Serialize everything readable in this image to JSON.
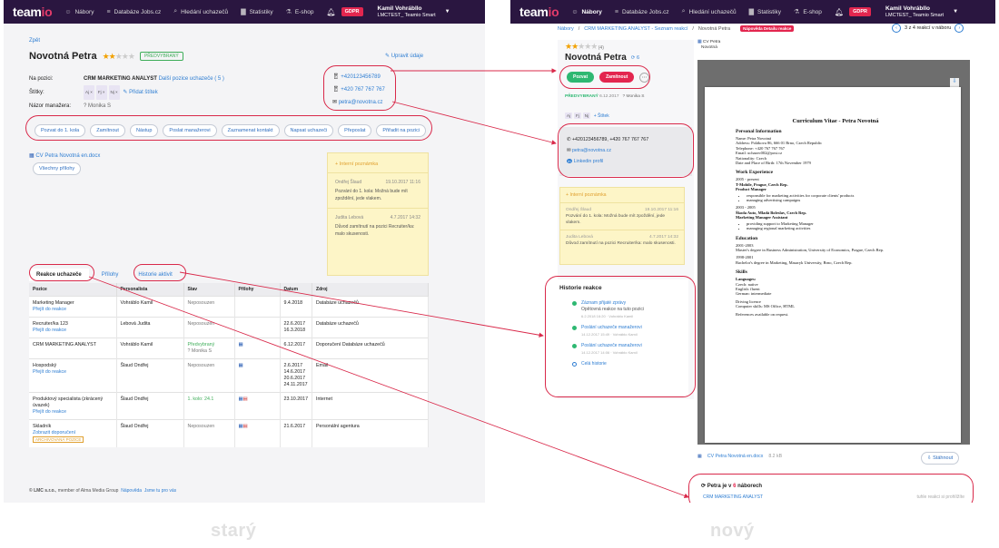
{
  "header": {
    "logo_main": "team",
    "logo_accent": "io",
    "nav": [
      {
        "icon": "people-icon",
        "glyph": "☺",
        "label": "Nábory"
      },
      {
        "icon": "database-icon",
        "glyph": "≡",
        "label": "Databáze Jobs.cz"
      },
      {
        "icon": "search-icon",
        "glyph": "⌕",
        "label": "Hledání uchazečů"
      },
      {
        "icon": "chart-icon",
        "glyph": "▇",
        "label": "Statistiky"
      },
      {
        "icon": "cart-icon",
        "glyph": "⚗",
        "label": "E-shop"
      }
    ],
    "gdpr": "GDPR",
    "user_name": "Kamil Vohrábllo",
    "user_company": "LMCTEST_ Teamio Smart"
  },
  "old": {
    "back": "Zpět",
    "name": "Novotná Petra",
    "status": "PŘEDVYBRANÝ",
    "edit": "Upravit údaje",
    "position_label": "Na pozici:",
    "position_value": "CRM MARKETING ANALYST",
    "position_more": "Další pozice uchazeče ( 5 )",
    "tags_label": "Štítky:",
    "tags": [
      "Aj",
      "Fj",
      "Nj"
    ],
    "add_tag": "Přidat štítek",
    "manager_label": "Názor manažera:",
    "manager_value": "Monika S",
    "phone1": "+420123456789",
    "phone2": "+420 767 767 767",
    "email": "petra@novotna.cz",
    "actions": [
      "Pozvat do 1. kola",
      "Zamítnout",
      "Nástup",
      "Poslat manažerovi",
      "Zaznamenat kontakt",
      "Napsat uchazeči",
      "Přeposlat",
      "Přiřadit na pozici"
    ],
    "cv_file": "CV Petra Novotná en.docx",
    "all_attachments": "Všechny přílohy",
    "notes_title": "Interní poznámka",
    "notes": [
      {
        "author": "Ondřej Šlaud",
        "date": "19.10.2017 11:16",
        "text": "Pozvání do 1. kola: Možná bude mít zpoždění, jede vlakem."
      },
      {
        "author": "Judita Lebová",
        "date": "4.7.2017 14:32",
        "text": "Důvod zamítnutí na pozici Recruiter/ka: malo skusenosti."
      }
    ],
    "tabs": [
      "Reakce uchazeče",
      "Přílohy",
      "Historie aktivit"
    ],
    "table_headers": [
      "Pozice",
      "Personalista",
      "Stav",
      "Přílohy",
      "Datum",
      "Zdroj"
    ],
    "rows": [
      {
        "pos": "Marketing Manager",
        "link": "Přejít do reakce",
        "hr": "Vohráblo Kamil",
        "state": "Neposouzen",
        "att": "",
        "date": "9.4.2018",
        "src": "Databáze uchazečů"
      },
      {
        "pos": "Recruiter/ka 123",
        "link": "Přejít do reakce",
        "hr": "Lebová Judita",
        "state": "Neposouzen",
        "att": "",
        "date": "22.6.2017 16.3.2018",
        "src": "Databáze uchazečů"
      },
      {
        "pos": "CRM MARKETING ANALYST",
        "link": "",
        "hr": "Vohráblo Kamil",
        "state": "Předvybraný",
        "state2": "Monika S",
        "att": "doc",
        "date": "6.12.2017",
        "src": "Doporučení Databáze uchazečů"
      },
      {
        "pos": "Hospodský",
        "link": "Přejít do reakce",
        "hr": "Šlaud Ondřej",
        "state": "Neposouzen",
        "att": "doc",
        "date": "2.6.2017 14.6.2017 20.6.2017 24.11.2017",
        "src": "Email"
      },
      {
        "pos": "Produktový specialista (zkrácený úvazek)",
        "link": "Přejít do reakce",
        "hr": "Šlaud Ondřej",
        "state": "1. kolo: 24.1",
        "att": "doc pdf",
        "date": "23.10.2017",
        "src": "Internet"
      },
      {
        "pos": "Skladník",
        "link": "Zobrazit doporučení",
        "archived": "ARCHIVOVANÁ POZICE",
        "hr": "Šlaud Ondřej",
        "state": "Neposouzen",
        "att": "doc pdf",
        "date": "21.6.2017",
        "src": "Personální agentura"
      }
    ],
    "footer_company": "© LMC s.r.o.",
    "footer_member": ", member of Alma Media Group",
    "footer_help": "Nápověda",
    "footer_terms": "Jsme tu pro vás"
  },
  "new": {
    "breadcrumb": [
      "Nábory",
      "CRM MARKETING ANALYST - Seznam reakcí",
      "Novotná Petra"
    ],
    "new_tag": "Nápověda Detailu reakce",
    "pager": "3 z 4 reakcí v náboru",
    "rating_count": "(4)",
    "name": "Novotná Petra",
    "views": "6",
    "btn_invite": "Pozvat",
    "btn_reject": "Zamítnout",
    "status": "PŘEDVYBRANÝ",
    "status_date": "6.12.2017",
    "manager": "Monika S",
    "tags": [
      "Aj",
      "Fj",
      "Nj"
    ],
    "add_tag": "+ Štítek",
    "phones": "+420123456789, +420 767 767 767",
    "email": "petra@novotna.cz",
    "linkedin": "Linkedin profil",
    "notes_title": "+ Interní poznámka",
    "notes": [
      {
        "author": "Ondřej Šlaud",
        "date": "19.10.2017 11:16",
        "text": "Pozvání do 1. kola: Možná bude mít zpoždění, jede vlakem."
      },
      {
        "author": "Judita Lebová",
        "date": "4.7.2017 14:32",
        "text": "Důvod zamítnutí na pozici Recruiter/ka: malo skusenosti."
      }
    ],
    "history_title": "Historie reakce",
    "history": [
      {
        "title": "Záznam přijaté zprávy",
        "sub": "Opětovná reakce na tuto pozici",
        "meta": "6.2.2018 16:20 · Vohráblo Kamil"
      },
      {
        "title": "Poslání uchazeče manažerovi",
        "sub": "",
        "meta": "14.12.2017 15:49 · Vohráblo Kamil"
      },
      {
        "title": "Poslání uchazeče manažerovi",
        "sub": "",
        "meta": "14.12.2017 14:06 · Vohráblo Kamil"
      }
    ],
    "history_all": "Celá historie",
    "cv_tab_name": "CV Petra",
    "cv_tab_sub": "Novotná",
    "cv_file": "CV Petra Novotná en.docx",
    "cv_size": "8.2 kB",
    "download": "Stáhnout",
    "other_title_pre": "Petra je v",
    "other_count": "6",
    "other_title_post": "náborech",
    "other_first": "CRM MARKETING ANALYST",
    "other_first_note": "tuhle reakci si prohlížíte"
  },
  "cv": {
    "title": "Curriculum Vitae - Petra Novotná",
    "personal_h": "Personal Information",
    "personal": [
      "Name: Petra Novotná",
      "Address: Polákova 86, 666 01 Brno, Czech Republic",
      "Telephone: +420 767 767 767",
      "Email: uchazec002@post.cz",
      "Nationality: Czech",
      "Date and Place of Birth: 17th November 1979"
    ],
    "work_h": "Work Experience",
    "job1_dates": "2005 - present",
    "job1_company": "T-Mobile, Prague, Czech Rep.",
    "job1_role": "Product Manager",
    "job1_bullets": [
      "responsible for marketing activities for corporate clients' products",
      "managing advertising campaigns"
    ],
    "job2_dates": "2003 - 2005",
    "job2_company": "Škoda Auto, Mladá Boleslav, Czech Rep.",
    "job2_role": "Marketing Manager Assistant",
    "job2_bullets": [
      "providing support to Marketing Manager",
      "managing regional marketing activities"
    ],
    "edu_h": "Education",
    "edu": [
      "2001-2003",
      "Master's degree in Business Administration, University of Economics, Prague, Czech Rep.",
      "1998-2001",
      "Bachelor's degree in Marketing, Masaryk University, Brno, Czech Rep."
    ],
    "skills_h": "Skills",
    "lang_h": "Languages:",
    "skills": [
      "Czech: native",
      "English: fluent",
      "German: intermediate",
      "Driving licence",
      "Computer skills: MS Office, HTML",
      "References available on request."
    ]
  },
  "labels": {
    "old": "starý",
    "new": "nový"
  },
  "colors": {
    "header": "#2a1640",
    "accent": "#e23b6a",
    "highlight": "#d9294a",
    "link": "#2d7dd2",
    "success": "#2eb872"
  }
}
